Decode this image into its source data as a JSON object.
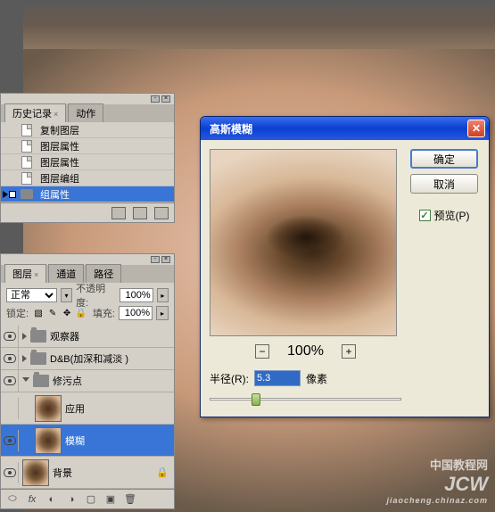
{
  "history": {
    "tabs": [
      {
        "label": "历史记录",
        "active": true
      },
      {
        "label": "动作",
        "active": false
      }
    ],
    "items": [
      {
        "label": "复制图层",
        "icon": "doc"
      },
      {
        "label": "图层属性",
        "icon": "doc"
      },
      {
        "label": "图层属性",
        "icon": "doc"
      },
      {
        "label": "图层编组",
        "icon": "doc"
      },
      {
        "label": "组属性",
        "icon": "folder",
        "selected": true
      }
    ]
  },
  "layers": {
    "tabs": [
      {
        "label": "图层",
        "active": true
      },
      {
        "label": "通道",
        "active": false
      },
      {
        "label": "路径",
        "active": false
      }
    ],
    "blend_mode": "正常",
    "opacity_label": "不透明度:",
    "opacity_value": "100%",
    "lock_label": "锁定:",
    "fill_label": "填充:",
    "fill_value": "100%",
    "items": [
      {
        "type": "group",
        "label": "观察器",
        "visible": true,
        "open": false
      },
      {
        "type": "group",
        "label": "D&B(加深和减淡 )",
        "visible": true,
        "open": false
      },
      {
        "type": "group",
        "label": "修污点",
        "visible": true,
        "open": true
      },
      {
        "type": "layer",
        "label": "应用",
        "visible": false,
        "indent": true
      },
      {
        "type": "layer",
        "label": "模糊",
        "visible": true,
        "indent": true,
        "selected": true
      },
      {
        "type": "layer",
        "label": "背景",
        "visible": true,
        "locked": true
      }
    ]
  },
  "dialog": {
    "title": "高斯模糊",
    "ok": "确定",
    "cancel": "取消",
    "preview": "预览(P)",
    "preview_checked": true,
    "zoom": "100%",
    "radius_label": "半径(R):",
    "radius_value": "5.3",
    "radius_unit": "像素"
  },
  "watermark": {
    "cn": "中国教程网",
    "en": "JCW",
    "sub": "jiaocheng.chinaz.com"
  }
}
